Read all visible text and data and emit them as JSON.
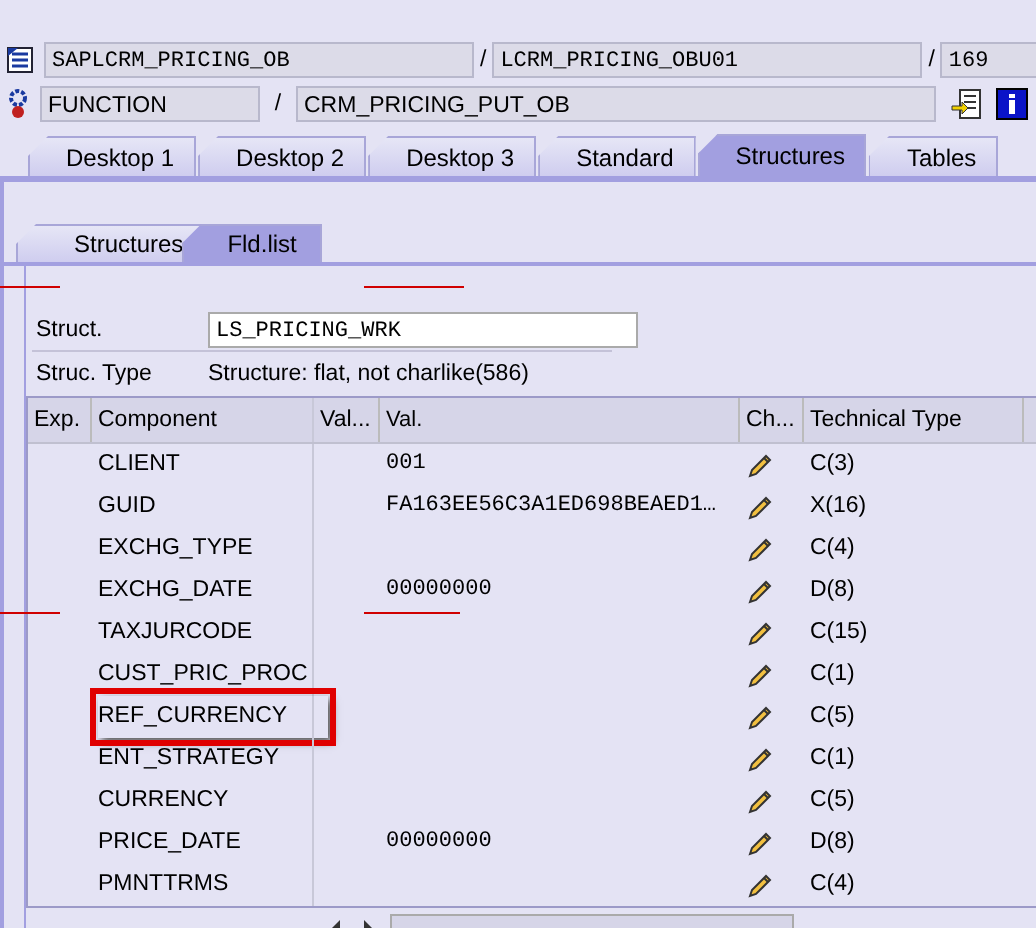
{
  "header": {
    "program": "SAPLCRM_PRICING_OB",
    "include": "LCRM_PRICING_OBU01",
    "line": "169",
    "event_type": "FUNCTION",
    "event_name": "CRM_PRICING_PUT_OB",
    "separators": [
      "/",
      "/",
      "/"
    ]
  },
  "tabs": [
    {
      "label": "Desktop 1",
      "selected": false
    },
    {
      "label": "Desktop 2",
      "selected": false
    },
    {
      "label": "Desktop 3",
      "selected": false
    },
    {
      "label": "Standard",
      "selected": false
    },
    {
      "label": "Structures",
      "selected": true
    },
    {
      "label": "Tables",
      "selected": false
    }
  ],
  "subtabs": [
    {
      "label": "Structures",
      "selected": false
    },
    {
      "label": "Fld.list",
      "selected": true
    }
  ],
  "struct": {
    "label": "Struct.",
    "value": "LS_PRICING_WRK"
  },
  "struc_type": {
    "label": "Struc. Type",
    "value": "Structure: flat, not charlike(586)"
  },
  "table": {
    "columns": [
      "Exp.",
      "Component",
      "Val...",
      "Val.",
      "Ch...",
      "Technical Type"
    ],
    "rows": [
      {
        "component": "CLIENT",
        "value": "001",
        "type": "C(3)",
        "highlighted": false
      },
      {
        "component": "GUID",
        "value": "FA163EE56C3A1ED698BEAED1…",
        "type": "X(16)",
        "highlighted": false
      },
      {
        "component": "EXCHG_TYPE",
        "value": "",
        "type": "C(4)",
        "highlighted": false
      },
      {
        "component": "EXCHG_DATE",
        "value": "00000000",
        "type": "D(8)",
        "highlighted": false
      },
      {
        "component": "TAXJURCODE",
        "value": "",
        "type": "C(15)",
        "highlighted": false
      },
      {
        "component": "CUST_PRIC_PROC",
        "value": "",
        "type": "C(1)",
        "highlighted": false
      },
      {
        "component": "REF_CURRENCY",
        "value": "",
        "type": "C(5)",
        "highlighted": true
      },
      {
        "component": "ENT_STRATEGY",
        "value": "",
        "type": "C(1)",
        "highlighted": false
      },
      {
        "component": "CURRENCY",
        "value": "",
        "type": "C(5)",
        "highlighted": false
      },
      {
        "component": "PRICE_DATE",
        "value": "00000000",
        "type": "D(8)",
        "highlighted": false
      },
      {
        "component": "PMNTTRMS",
        "value": "",
        "type": "C(4)",
        "highlighted": false
      }
    ]
  }
}
